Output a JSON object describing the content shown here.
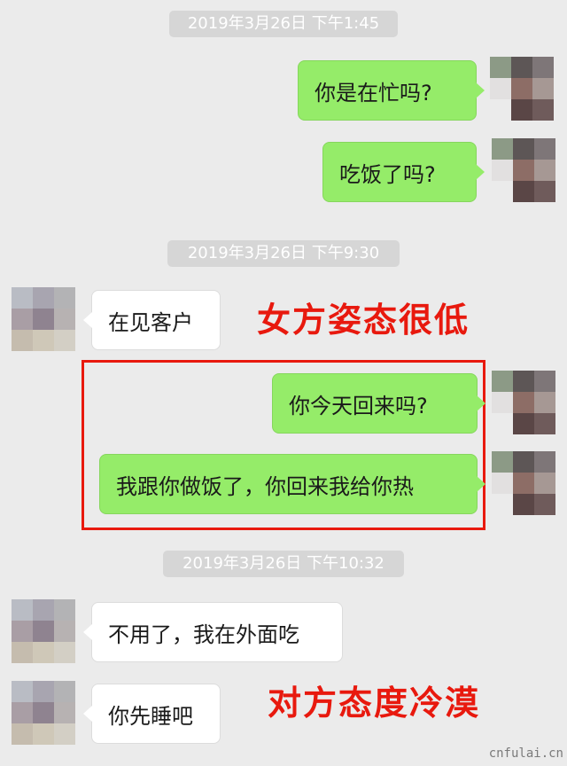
{
  "timestamps": [
    "2019年3月26日  下午1:45",
    "2019年3月26日  下午9:30",
    "2019年3月26日  下午10:32"
  ],
  "messages": [
    {
      "side": "sent",
      "text": "你是在忙吗?"
    },
    {
      "side": "sent",
      "text": "吃饭了吗?"
    },
    {
      "side": "received",
      "text": "在见客户"
    },
    {
      "side": "sent",
      "text": "你今天回来吗?"
    },
    {
      "side": "sent",
      "text": "我跟你做饭了，你回来我给你热"
    },
    {
      "side": "received",
      "text": "不用了，我在外面吃"
    },
    {
      "side": "received",
      "text": "你先睡吧"
    }
  ],
  "annotations": {
    "woman_low_stance": "女方姿态很低",
    "other_cold": "对方态度冷漠"
  },
  "watermark": "cnfulai.cn",
  "colors": {
    "background": "#ebebeb",
    "sent_bubble": "#95ec69",
    "received_bubble": "#ffffff",
    "annotation_red": "#e8190e"
  },
  "icons": {
    "sender_avatar": "pixelated-avatar",
    "receiver_avatar": "pixelated-avatar"
  }
}
